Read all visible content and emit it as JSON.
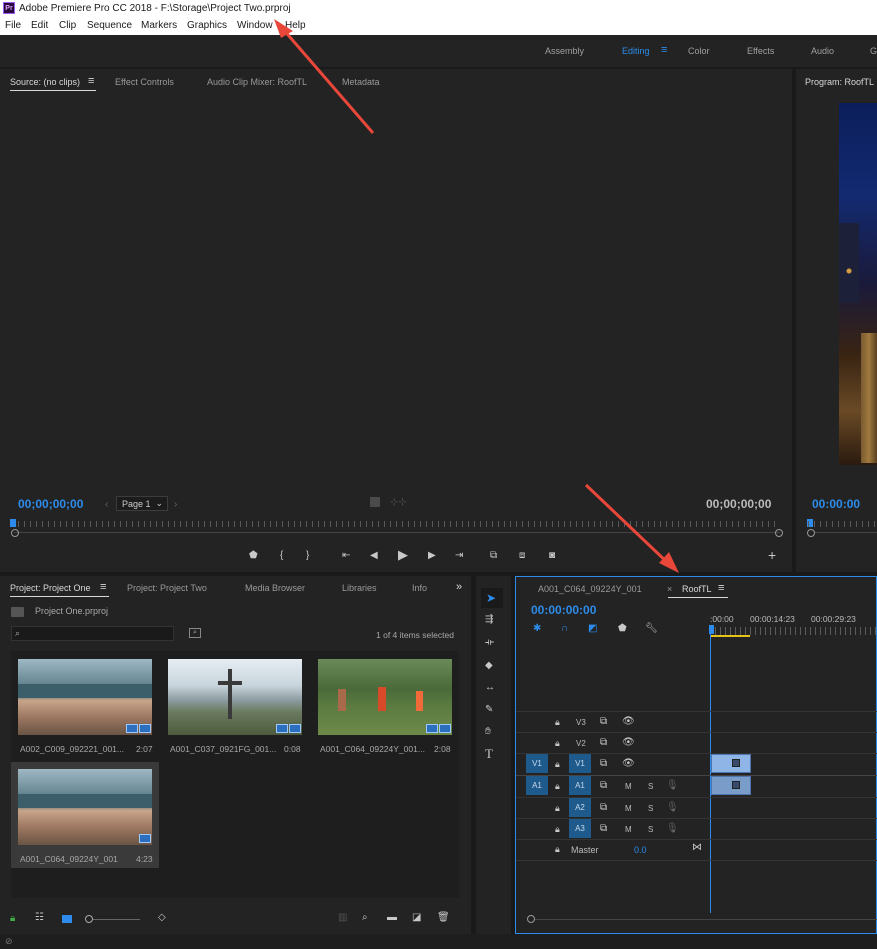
{
  "window": {
    "title": "Adobe Premiere Pro CC 2018 - F:\\Storage\\Project Two.prproj",
    "app_icon": "Pr"
  },
  "menu": [
    "File",
    "Edit",
    "Clip",
    "Sequence",
    "Markers",
    "Graphics",
    "Window",
    "Help"
  ],
  "workspaces": {
    "items": [
      "Assembly",
      "Editing",
      "Color",
      "Effects",
      "Audio",
      "G"
    ],
    "active": "Editing"
  },
  "source_panel": {
    "tabs": [
      "Source: (no clips)",
      "Effect Controls",
      "Audio Clip Mixer: RoofTL",
      "Metadata"
    ],
    "timecode_left": "00;00;00;00",
    "timecode_right": "00;00;00;00",
    "page_select": "Page 1"
  },
  "program_panel": {
    "tab": "Program: RoofTL",
    "timecode": "00:00:00"
  },
  "project_panel": {
    "tabs": [
      "Project: Project One",
      "Project: Project Two",
      "Media Browser",
      "Libraries",
      "Info"
    ],
    "file": "Project One.prproj",
    "selection_status": "1 of 4 items selected",
    "items": [
      {
        "name": "A002_C009_092221_001...",
        "duration": "2:07"
      },
      {
        "name": "A001_C037_0921FG_001...",
        "duration": "0:08"
      },
      {
        "name": "A001_C064_09224Y_001...",
        "duration": "2:08"
      },
      {
        "name": "A001_C064_09224Y_001",
        "duration": "4:23"
      }
    ]
  },
  "timeline": {
    "tabs": [
      "A001_C064_09224Y_001",
      "RoofTL"
    ],
    "timecode": "00:00:00:00",
    "ruler": [
      ":00:00",
      "00:00:14:23",
      "00:00:29:23"
    ],
    "tracks": [
      {
        "name": "V3"
      },
      {
        "name": "V2"
      },
      {
        "name": "V1",
        "source": "V1"
      },
      {
        "name": "A1",
        "source": "A1",
        "m": "M",
        "s": "S"
      },
      {
        "name": "A2",
        "m": "M",
        "s": "S"
      },
      {
        "name": "A3",
        "m": "M",
        "s": "S"
      }
    ],
    "master_label": "Master",
    "master_value": "0.0"
  },
  "tools": [
    "selection",
    "track-select",
    "ripple-edit",
    "razor",
    "slip",
    "pen",
    "hand",
    "type"
  ],
  "colors": {
    "accent": "#2d8ceb",
    "annotation_arrow": "#e8473a"
  }
}
